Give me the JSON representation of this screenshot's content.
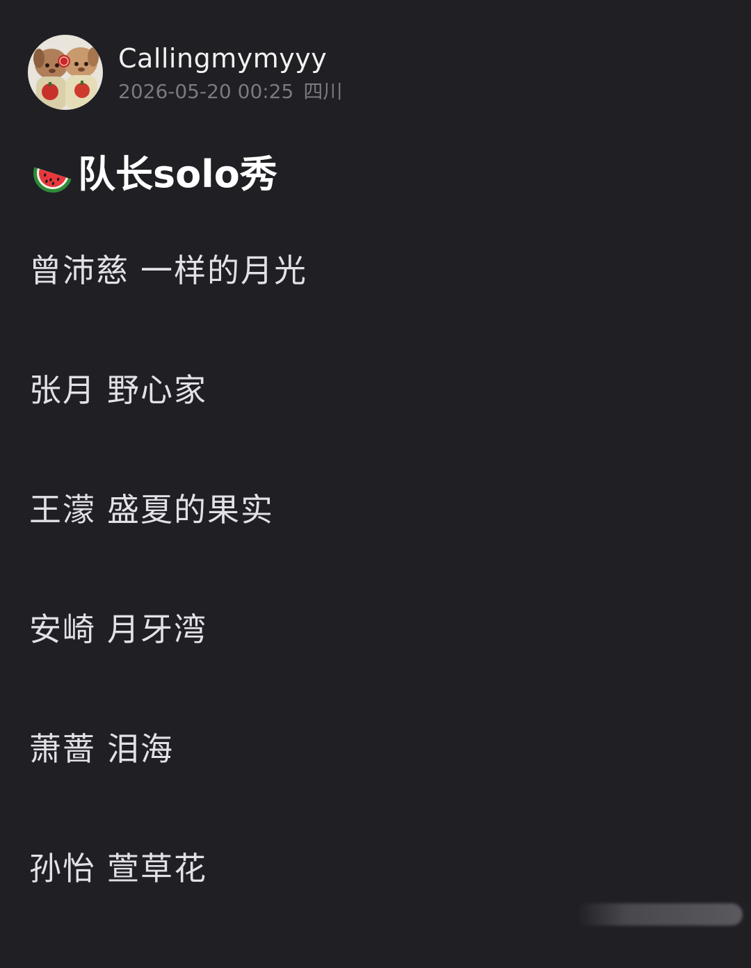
{
  "post": {
    "username": "Callingmymyyy",
    "timestamp": "2026-05-20 00:25",
    "location": "四川",
    "avatar_icon": "plush-toys-avatar"
  },
  "title": {
    "icon": "watermelon-icon",
    "text": "队长solo秀"
  },
  "songs": [
    {
      "artist": "曾沛慈",
      "song": "一样的月光"
    },
    {
      "artist": "张月",
      "song": "野心家"
    },
    {
      "artist": "王濛",
      "song": "盛夏的果实"
    },
    {
      "artist": "安崎",
      "song": "月牙湾"
    },
    {
      "artist": "萧蔷",
      "song": "泪海"
    },
    {
      "artist": "孙怡",
      "song": "萱草花"
    }
  ],
  "colors": {
    "background": "#1f1f24",
    "primary_text": "#f2f2f2",
    "secondary_text": "#7a7a80"
  }
}
